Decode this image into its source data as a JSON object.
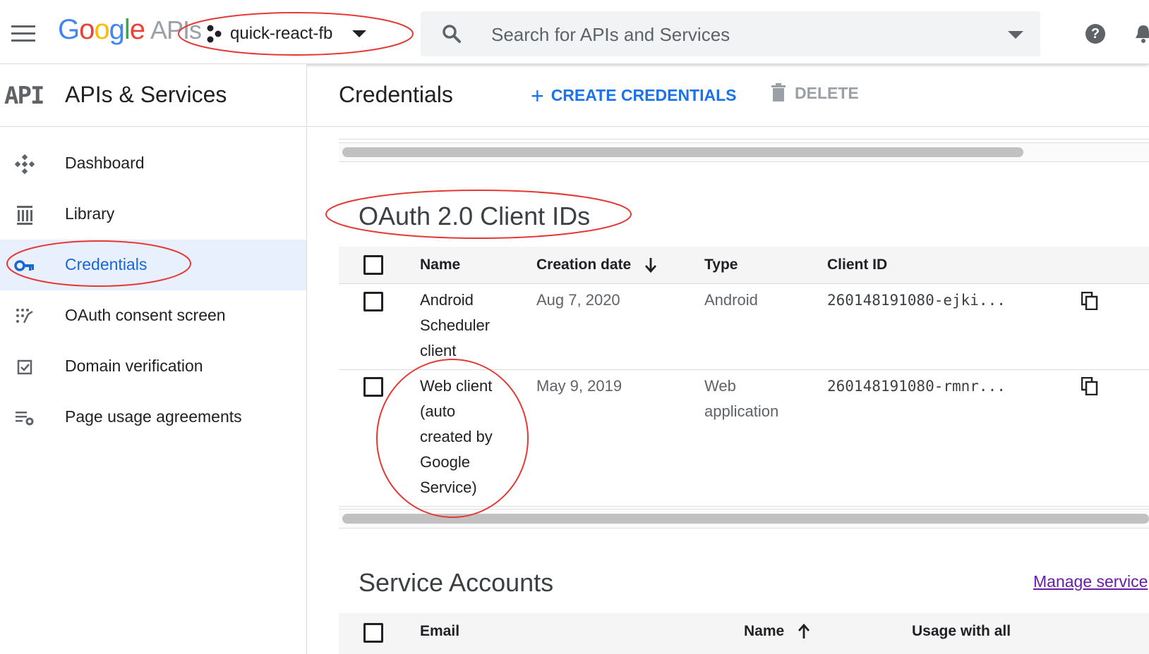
{
  "topbar": {
    "logo_text": "Google",
    "logo_suffix": "APIs",
    "project_name": "quick-react-fb",
    "search_placeholder": "Search for APIs and Services"
  },
  "sidebar": {
    "logo": "API",
    "title": "APIs & Services",
    "items": [
      {
        "label": "Dashboard",
        "icon": "dashboard-icon",
        "active": false
      },
      {
        "label": "Library",
        "icon": "library-icon",
        "active": false
      },
      {
        "label": "Credentials",
        "icon": "key-icon",
        "active": true
      },
      {
        "label": "OAuth consent screen",
        "icon": "consent-icon",
        "active": false
      },
      {
        "label": "Domain verification",
        "icon": "checkbox-icon",
        "active": false
      },
      {
        "label": "Page usage agreements",
        "icon": "settings-list-icon",
        "active": false
      }
    ]
  },
  "main": {
    "title": "Credentials",
    "create_label": "CREATE CREDENTIALS",
    "delete_label": "DELETE",
    "oauth": {
      "title": "OAuth 2.0 Client IDs",
      "columns": [
        "Name",
        "Creation date",
        "Type",
        "Client ID"
      ],
      "rows": [
        {
          "name": "Android Scheduler client",
          "name_lines": [
            "Android",
            "Scheduler",
            "client"
          ],
          "date": "Aug 7, 2020",
          "type_lines": [
            "Android"
          ],
          "client_id": "260148191080-ejki..."
        },
        {
          "name": "Web client (auto created by Google Service)",
          "name_lines": [
            "Web client",
            "(auto",
            "created by",
            "Google",
            "Service)"
          ],
          "date": "May 9, 2019",
          "type_lines": [
            "Web",
            "application"
          ],
          "client_id": "260148191080-rmnr..."
        }
      ]
    },
    "service_accounts": {
      "title": "Service Accounts",
      "manage_link": "Manage service",
      "columns": [
        "Email",
        "Name",
        "Usage with all"
      ]
    }
  },
  "colors": {
    "accent": "#1a73e8",
    "active_bg": "#e8f0fe",
    "annotation_red": "#e53935"
  }
}
